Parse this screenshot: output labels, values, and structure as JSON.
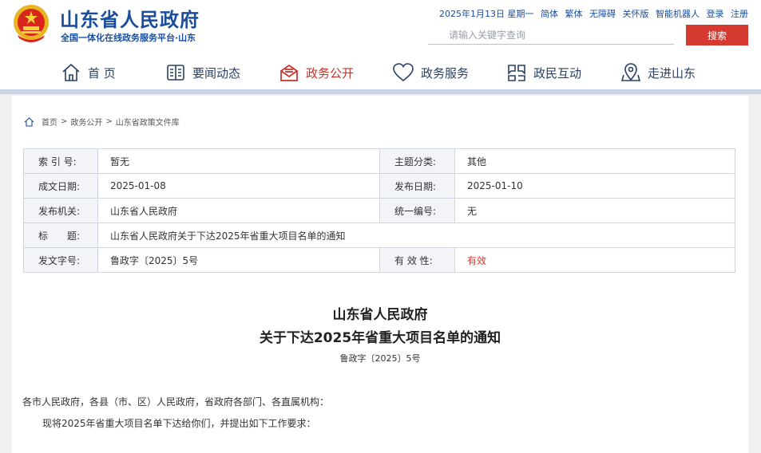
{
  "header": {
    "title": "山东省人民政府",
    "subtitle": "全国一体化在线政务服务平台·山东",
    "date": "2025年1月13日 星期一",
    "links": [
      "简体",
      "繁体",
      "无障碍",
      "关怀版",
      "智能机器人",
      "登录",
      "注册"
    ],
    "search": {
      "placeholder": "请输入关键字查询",
      "button": "搜索"
    }
  },
  "nav": [
    {
      "label": "首 页",
      "icon": "home-icon"
    },
    {
      "label": "要闻动态",
      "icon": "newspaper-icon"
    },
    {
      "label": "政务公开",
      "icon": "mail-open-icon",
      "active": true
    },
    {
      "label": "政务服务",
      "icon": "heart-icon"
    },
    {
      "label": "政民互动",
      "icon": "chat-icon"
    },
    {
      "label": "走进山东",
      "icon": "map-pin-icon"
    }
  ],
  "breadcrumb": [
    "首页",
    "政务公开",
    "山东省政策文件库"
  ],
  "meta": {
    "index_no": {
      "label": "索 引 号:",
      "value": "暂无"
    },
    "category": {
      "label": "主题分类:",
      "value": "其他"
    },
    "created": {
      "label": "成文日期:",
      "value": "2025-01-08"
    },
    "published": {
      "label": "发布日期:",
      "value": "2025-01-10"
    },
    "issuer": {
      "label": "发布机关:",
      "value": "山东省人民政府"
    },
    "unified_no": {
      "label": "统一编号:",
      "value": "无"
    },
    "title": {
      "label": "标　　题:",
      "value": "山东省人民政府关于下达2025年省重大项目名单的通知"
    },
    "doc_no": {
      "label": "发文字号:",
      "value": "鲁政字〔2025〕5号"
    },
    "validity": {
      "label": "有 效 性:",
      "value": "有效"
    }
  },
  "document": {
    "title_line1": "山东省人民政府",
    "title_line2": "关于下达2025年省重大项目名单的通知",
    "number": "鲁政字〔2025〕5号",
    "paragraphs": [
      "各市人民政府，各县（市、区）人民政府，省政府各部门、各直属机构：",
      "现将2025年省重大项目名单下达给你们，并提出如下工作要求："
    ]
  },
  "colors": {
    "brand_blue": "#1a4d9c",
    "accent_red": "#d6392f",
    "strip": "#c9d5e6"
  }
}
